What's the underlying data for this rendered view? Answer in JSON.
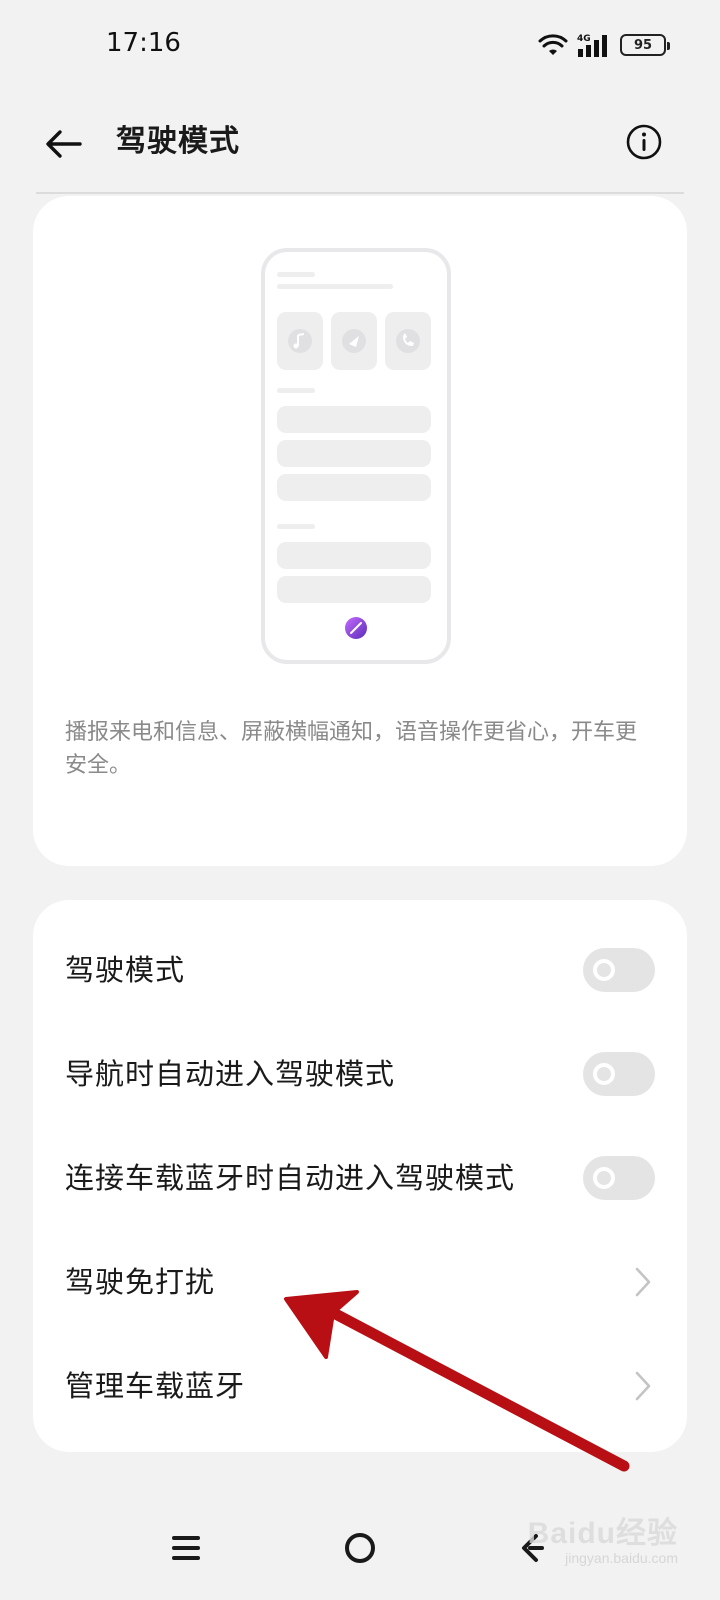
{
  "status_bar": {
    "time": "17:16",
    "network": "4G",
    "battery": "95"
  },
  "header": {
    "title": "驾驶模式",
    "back_icon": "arrow-left-icon",
    "info_icon": "info-icon"
  },
  "intro_card": {
    "description": "播报来电和信息、屏蔽横幅通知，语音操作更省心，开车更安全。"
  },
  "settings": {
    "rows": [
      {
        "label": "驾驶模式",
        "control": "toggle",
        "on": false
      },
      {
        "label": "导航时自动进入驾驶模式",
        "control": "toggle",
        "on": false
      },
      {
        "label": "连接车载蓝牙时自动进入驾驶模式",
        "control": "toggle",
        "on": false
      },
      {
        "label": "驾驶免打扰",
        "control": "chevron"
      },
      {
        "label": "管理车载蓝牙",
        "control": "chevron"
      }
    ]
  },
  "annotation": {
    "color": "#b80f14"
  },
  "nav_bar": {
    "buttons": [
      "menu-icon",
      "home-icon",
      "back-icon"
    ]
  },
  "watermark": {
    "brand": "Baidu经验",
    "sub": "jingyan.baidu.com"
  }
}
